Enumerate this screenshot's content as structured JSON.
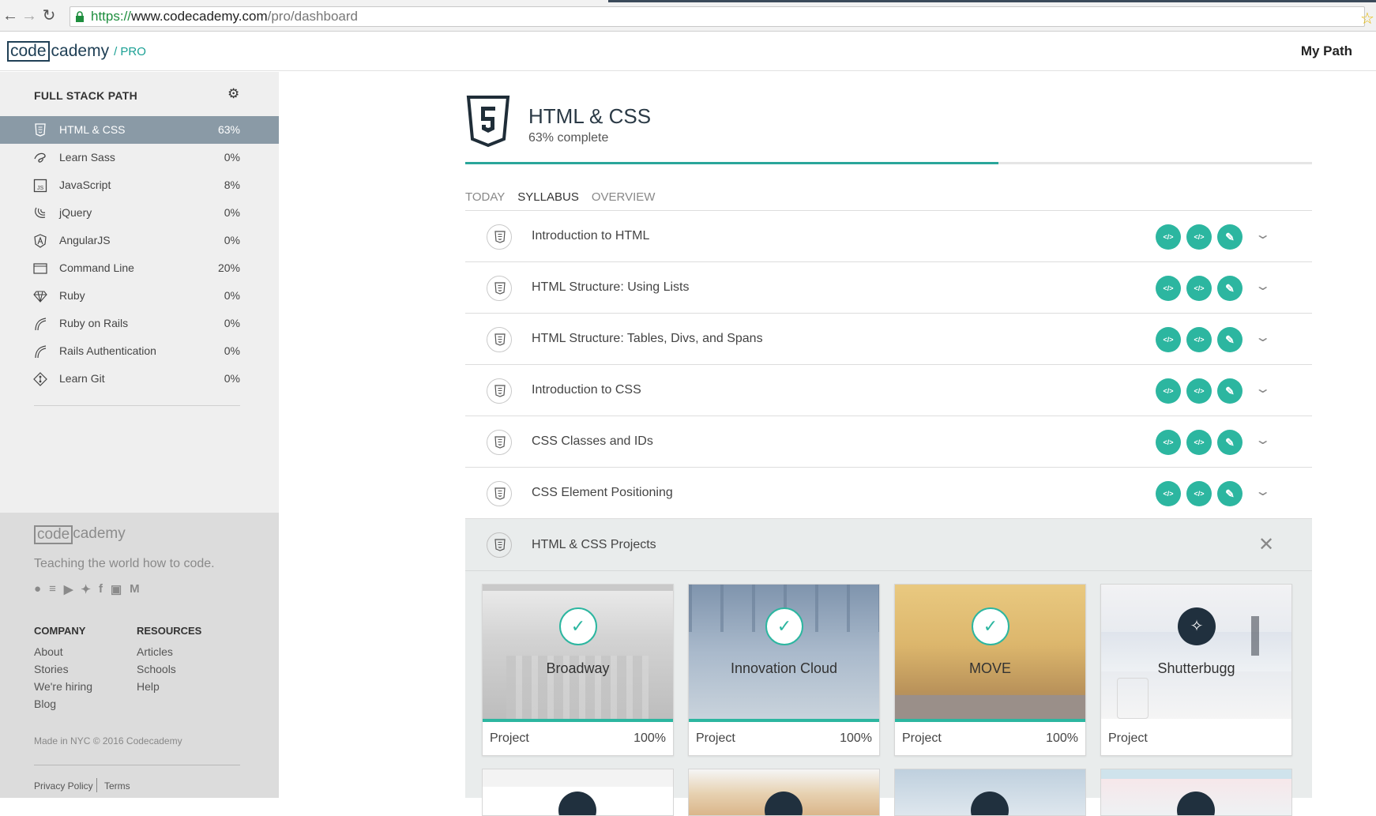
{
  "browser": {
    "url_protocol": "https://",
    "url_host": "www.codecademy.com",
    "url_path": "/pro/dashboard"
  },
  "header": {
    "logo_code": "code",
    "logo_rest": "cademy",
    "logo_pro": "/ PRO",
    "nav_label": "My Path"
  },
  "sidebar": {
    "title": "FULL STACK PATH",
    "items": [
      {
        "label": "HTML & CSS",
        "pct": "63%",
        "icon": "html5-icon"
      },
      {
        "label": "Learn Sass",
        "pct": "0%",
        "icon": "sass-icon"
      },
      {
        "label": "JavaScript",
        "pct": "8%",
        "icon": "js-icon"
      },
      {
        "label": "jQuery",
        "pct": "0%",
        "icon": "jquery-icon"
      },
      {
        "label": "AngularJS",
        "pct": "0%",
        "icon": "angular-icon"
      },
      {
        "label": "Command Line",
        "pct": "20%",
        "icon": "terminal-icon"
      },
      {
        "label": "Ruby",
        "pct": "0%",
        "icon": "ruby-icon"
      },
      {
        "label": "Ruby on Rails",
        "pct": "0%",
        "icon": "rails-icon"
      },
      {
        "label": "Rails Authentication",
        "pct": "0%",
        "icon": "rails-icon"
      },
      {
        "label": "Learn Git",
        "pct": "0%",
        "icon": "git-icon"
      }
    ]
  },
  "footer": {
    "logo_code": "code",
    "logo_rest": "cademy",
    "tagline": "Teaching the world how to code.",
    "social": [
      "reddit-icon",
      "stackoverflow-icon",
      "youtube-icon",
      "twitter-icon",
      "facebook-icon",
      "instagram-icon",
      "medium-icon"
    ],
    "company_head": "COMPANY",
    "company_links": [
      "About",
      "Stories",
      "We're hiring",
      "Blog"
    ],
    "resources_head": "RESOURCES",
    "resources_links": [
      "Articles",
      "Schools",
      "Help"
    ],
    "made": "Made in NYC © 2016 Codecademy",
    "privacy": "Privacy Policy",
    "terms": "Terms"
  },
  "course": {
    "title": "HTML & CSS",
    "subtitle": "63% complete",
    "progress": 0.63
  },
  "tabs": [
    "TODAY",
    "SYLLABUS",
    "OVERVIEW"
  ],
  "lessons": [
    {
      "title": "Introduction to HTML"
    },
    {
      "title": "HTML Structure: Using Lists"
    },
    {
      "title": "HTML Structure: Tables, Divs, and Spans"
    },
    {
      "title": "Introduction to CSS"
    },
    {
      "title": "CSS Classes and IDs"
    },
    {
      "title": "CSS Element Positioning"
    }
  ],
  "lesson_buttons": [
    "</>",
    "</>",
    "✎"
  ],
  "projects": {
    "title": "HTML & CSS Projects",
    "cards": [
      {
        "name": "Broadway",
        "type": "Project",
        "pct": "100%",
        "status": "complete"
      },
      {
        "name": "Innovation Cloud",
        "type": "Project",
        "pct": "100%",
        "status": "complete"
      },
      {
        "name": "MOVE",
        "type": "Project",
        "pct": "100%",
        "status": "complete"
      },
      {
        "name": "Shutterbugg",
        "type": "Project",
        "pct": "",
        "status": "locked"
      }
    ]
  },
  "colors": {
    "accent": "#2cb6a0",
    "sidebar_active": "#8a9aa6",
    "dark": "#20303e"
  }
}
